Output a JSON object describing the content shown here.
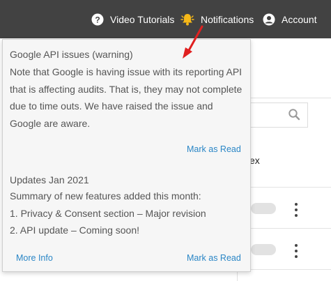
{
  "header": {
    "video_tutorials": "Video Tutorials",
    "notifications": "Notifications",
    "account": "Account"
  },
  "notifications": [
    {
      "title": "Google API issues (warning)",
      "body": "Note that Google is having issue with its reporting API that is affecting audits. That is, they may not complete due to time outs. We have raised the issue and Google are aware.",
      "mark_read": "Mark as Read"
    },
    {
      "title": "Updates Jan 2021",
      "body_lines": [
        "Summary of new features added this month:",
        "1. Privacy & Consent section – Major revision",
        "2. API update – Coming soon!"
      ],
      "more_info": "More Info",
      "mark_read": "Mark as Read"
    }
  ],
  "background": {
    "col_text_1": "ex",
    "col_text_2": ")"
  },
  "colors": {
    "topbar": "#424242",
    "link": "#2a86c6",
    "bell": "#f6b818",
    "arrow": "#e02020"
  },
  "icons": {
    "video_tutorials": "question-circle-icon",
    "notifications": "bell-icon",
    "account": "user-circle-icon",
    "search": "search-icon"
  }
}
